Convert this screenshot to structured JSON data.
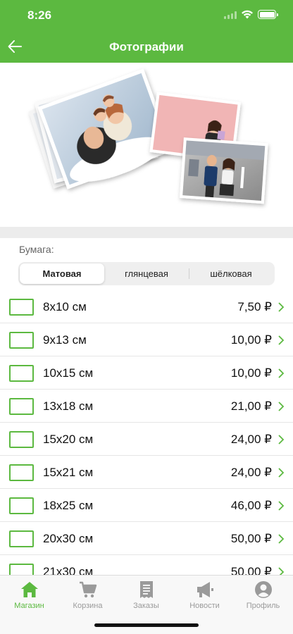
{
  "status": {
    "time": "8:26"
  },
  "nav": {
    "title": "Фотографии",
    "back_icon": "arrow-left-icon"
  },
  "paper": {
    "label": "Бумага:",
    "options": [
      "Матовая",
      "глянцевая",
      "шёлковая"
    ],
    "selected": "Матовая"
  },
  "sizes": [
    {
      "size": "8x10 см",
      "price": "7,50 ₽"
    },
    {
      "size": "9x13 см",
      "price": "10,00 ₽"
    },
    {
      "size": "10x15 см",
      "price": "10,00 ₽"
    },
    {
      "size": "13x18 см",
      "price": "21,00 ₽"
    },
    {
      "size": "15x20 см",
      "price": "24,00 ₽"
    },
    {
      "size": "15x21 см",
      "price": "24,00 ₽"
    },
    {
      "size": "18x25 см",
      "price": "46,00 ₽"
    },
    {
      "size": "20x30 см",
      "price": "50,00 ₽"
    },
    {
      "size": "21x30 см",
      "price": "50,00 ₽"
    }
  ],
  "tabs": [
    {
      "label": "Магазин",
      "icon": "home-icon",
      "active": true
    },
    {
      "label": "Корзина",
      "icon": "cart-icon",
      "active": false
    },
    {
      "label": "Заказы",
      "icon": "receipt-icon",
      "active": false
    },
    {
      "label": "Новости",
      "icon": "megaphone-icon",
      "active": false
    },
    {
      "label": "Профиль",
      "icon": "profile-icon",
      "active": false
    }
  ],
  "colors": {
    "accent": "#5cb940",
    "tab_inactive": "#9a9a9a"
  }
}
